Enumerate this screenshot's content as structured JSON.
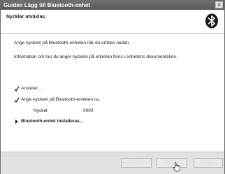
{
  "window": {
    "title": "Guiden Lägg till Bluetooth-enhet",
    "close_label": "×"
  },
  "header": {
    "title": "Nycklar utväxlas.",
    "logo_icon": "bluetooth-icon"
  },
  "body": {
    "paragraph1": "Ange nyckeln på Bluetooth-enheten när du ombes nedan.",
    "paragraph2": "Information om hur du anger nyckeln på enheten finns i enhetens dokumentation.",
    "steps": [
      {
        "label": "Ansluter...",
        "state": "done"
      },
      {
        "label": "Ange nyckeln på Bluetooth-enheten nu.",
        "state": "done"
      },
      {
        "label": "Bluetooth-enhet installeras...",
        "state": "current"
      }
    ],
    "key_label": "Nyckel:",
    "key_value": "0000"
  },
  "footer": {
    "back_label": "< Föregående",
    "next_label": "Nästa >",
    "cancel_label": "Avbryt"
  },
  "colors": {
    "titlebar": "#5f5f5f",
    "footer": "#e2e2e2",
    "disabled_text": "#ffffff"
  }
}
